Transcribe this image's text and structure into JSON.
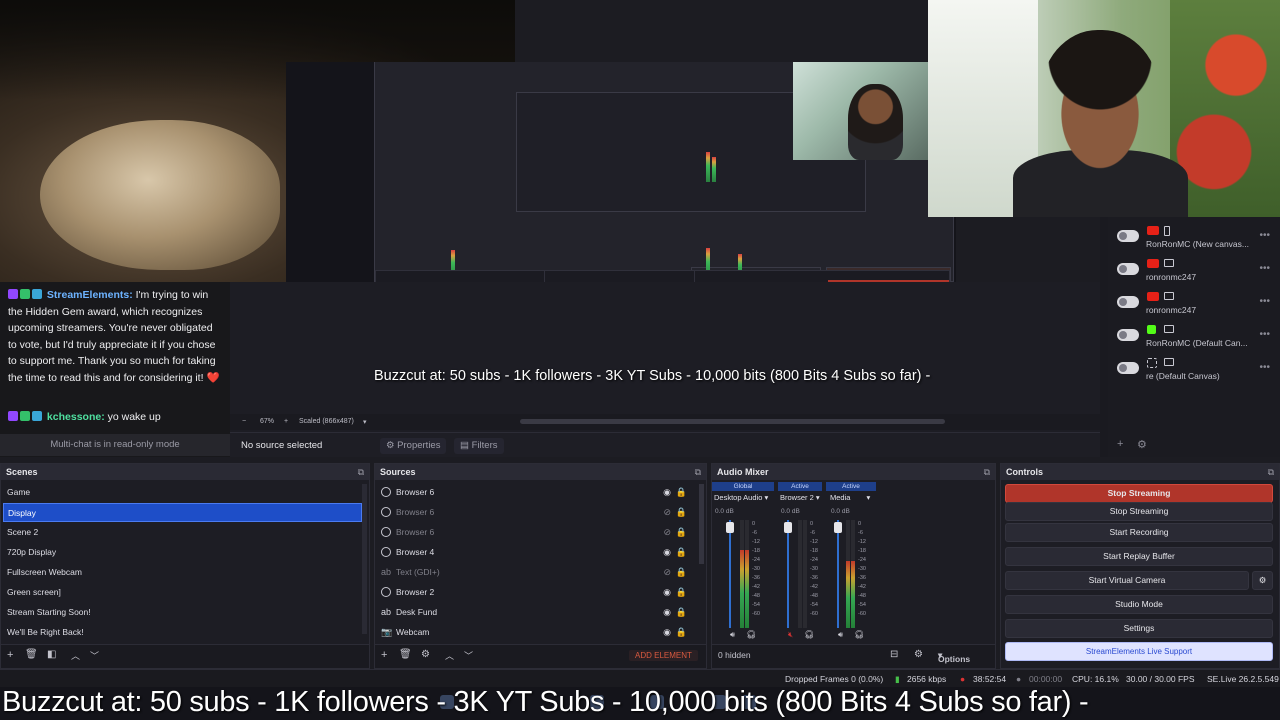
{
  "chat": {
    "msg1_user": "StreamElements:",
    "msg1_text": " I'm trying to win the Hidden Gem award, which recognizes upcoming streamers. You're never obligated to vote, but I'd truly appreciate it if you chose to support me. Thank you so much for taking the time to read this and for considering it! ❤️",
    "msg2_user": "kchessone:",
    "msg2_text": " yo wake up",
    "readonly_notice": "Multi-chat is in read-only mode"
  },
  "preview": {
    "overlay_text": "Buzzcut at: 50 subs - 1K followers - 3K YT Subs - 10,000 bits (800 Bits 4 Subs so far) -",
    "zoom_minus": "−",
    "zoom_value": "67%",
    "zoom_plus": "+",
    "scaled_label": "Scaled (866x487)",
    "no_source": "No source selected",
    "properties_label": "Properties",
    "filters_label": "Filters"
  },
  "right_panel": {
    "items": [
      {
        "label": "RonRonMC (New canvas..."
      },
      {
        "label": "ronronmc247"
      },
      {
        "label": "ronronmc247"
      },
      {
        "label": "RonRonMC (Default Can..."
      },
      {
        "label": "re (Default Canvas)"
      }
    ],
    "add_icon": "+",
    "settings_icon": "⚙"
  },
  "scenes": {
    "title": "Scenes",
    "items": [
      "Game",
      "Display",
      "Scene 2",
      "720p Display",
      "Fullscreen Webcam",
      "Green screen]",
      "Stream Starting Soon!",
      "We'll Be Right Back!"
    ],
    "selected_index": 1
  },
  "sources": {
    "title": "Sources",
    "items": [
      {
        "label": "Browser 6",
        "visible": true
      },
      {
        "label": "Browser 6",
        "visible": false
      },
      {
        "label": "Browser 6",
        "visible": false
      },
      {
        "label": "Browser 4",
        "visible": true
      },
      {
        "label": "Text (GDI+)",
        "visible": false
      },
      {
        "label": "Browser 2",
        "visible": true
      },
      {
        "label": "Desk Fund",
        "visible": true
      },
      {
        "label": "Webcam",
        "visible": true
      }
    ],
    "add_element": "ADD ELEMENT"
  },
  "mixer": {
    "title": "Audio Mixer",
    "tabs": [
      "Global",
      "Active",
      "Active"
    ],
    "channels": [
      {
        "name": "Desktop Audio",
        "db": "0.0 dB",
        "level": 0.72,
        "muted": false
      },
      {
        "name": "Browser 2",
        "db": "0.0 dB",
        "level": 0.0,
        "muted": true
      },
      {
        "name": "Media",
        "db": "0.0 dB",
        "level": 0.62,
        "muted": false
      }
    ],
    "scale": [
      "0",
      "-6",
      "-12",
      "-18",
      "-24",
      "-30",
      "-36",
      "-42",
      "-48",
      "-54",
      "-60"
    ],
    "hidden": "0 hidden",
    "options": "Options"
  },
  "controls": {
    "title": "Controls",
    "buttons": [
      "Stop Streaming",
      "Stop Streaming",
      "Start Recording",
      "Start Replay Buffer",
      "Start Virtual Camera",
      "Studio Mode",
      "Settings"
    ],
    "support": "StreamElements Live Support"
  },
  "status": {
    "dropped": "Dropped Frames 0 (0.0%)",
    "bitrate": "2656 kbps",
    "live_time": "38:52:54",
    "rec_time": "00:00:00",
    "cpu": "CPU: 16.1%",
    "fps": "30.00 / 30.00 FPS",
    "version": "SE.Live 26.2.5.549"
  },
  "ticker": {
    "text": "Buzzcut at: 50 subs - 1K followers - 3K YT Subs - 10,000 bits (800 Bits 4 Subs so far) -"
  },
  "colors": {
    "accent_blue": "#1e4ec8",
    "stream_red": "#b0352a",
    "twitch_purple": "#9147ff",
    "youtube_red": "#e62117",
    "kick_green": "#53fc18"
  }
}
